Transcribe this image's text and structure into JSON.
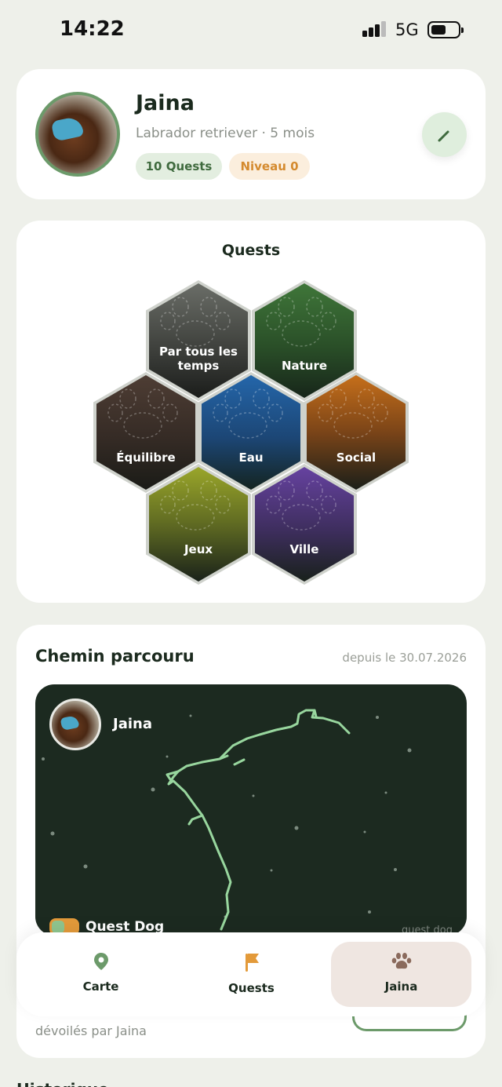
{
  "status_bar": {
    "time": "14:22",
    "network": "5G"
  },
  "profile": {
    "name": "Jaina",
    "breed_line": "Labrador retriever · 5 mois",
    "quests_badge": "10 Quests",
    "level_badge": "Niveau 0",
    "edit_icon": "pencil-icon"
  },
  "quests": {
    "title": "Quests",
    "categories": [
      {
        "label": "Par tous les temps",
        "color": "#55584f"
      },
      {
        "label": "Nature",
        "color": "#3c6e37"
      },
      {
        "label": "Équilibre",
        "color": "#4b3a32"
      },
      {
        "label": "Eau",
        "color": "#225c9c"
      },
      {
        "label": "Social",
        "color": "#b86618"
      },
      {
        "label": "Jeux",
        "color": "#8f9a24"
      },
      {
        "label": "Ville",
        "color": "#5d3b8e"
      }
    ]
  },
  "path": {
    "title": "Chemin parcouru",
    "since": "depuis le 30.07.2026",
    "map_name": "Jaina",
    "brand": "Quest Dog",
    "brand_right": "quest dog",
    "unlocked_text": "dévoilés par Jaina"
  },
  "next_section": {
    "title": "Historique"
  },
  "tabbar": {
    "tabs": [
      {
        "label": "Carte",
        "icon": "map-pin-icon",
        "color": "#6c9a6a"
      },
      {
        "label": "Quests",
        "icon": "flag-icon",
        "color": "#e39a3a"
      },
      {
        "label": "Jaina",
        "icon": "paw-icon",
        "color": "#8a6a5c"
      }
    ],
    "active": "Jaina"
  }
}
